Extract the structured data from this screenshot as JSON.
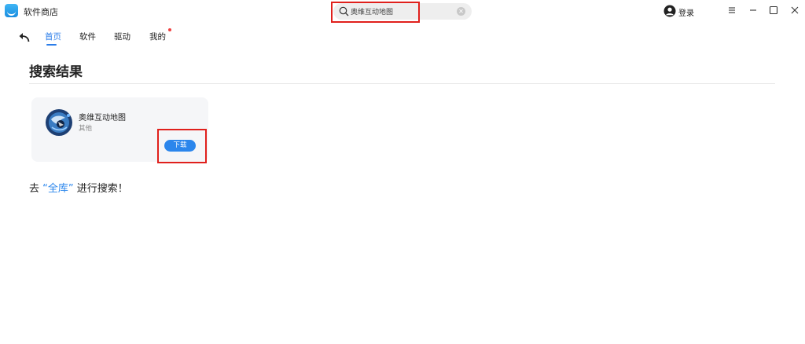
{
  "app": {
    "title": "软件商店"
  },
  "search": {
    "value": "奥维互动地图",
    "clear_icon": "close-circle-icon"
  },
  "header": {
    "login_label": "登录"
  },
  "nav": {
    "tabs": [
      {
        "label": "首页",
        "active": true
      },
      {
        "label": "软件",
        "active": false
      },
      {
        "label": "驱动",
        "active": false
      },
      {
        "label": "我的",
        "active": false,
        "badge_dot": true
      }
    ]
  },
  "main": {
    "title": "搜索结果",
    "results": [
      {
        "name": "奥维互动地图",
        "category": "其他",
        "action_label": "下载"
      }
    ],
    "search_all": {
      "prefix": "去",
      "link": "“全库”",
      "suffix": "进行搜索！"
    }
  },
  "colors": {
    "accent": "#2b7de9",
    "button": "#2b86ec",
    "highlight_box": "#e0201c",
    "badge": "#f04040"
  }
}
